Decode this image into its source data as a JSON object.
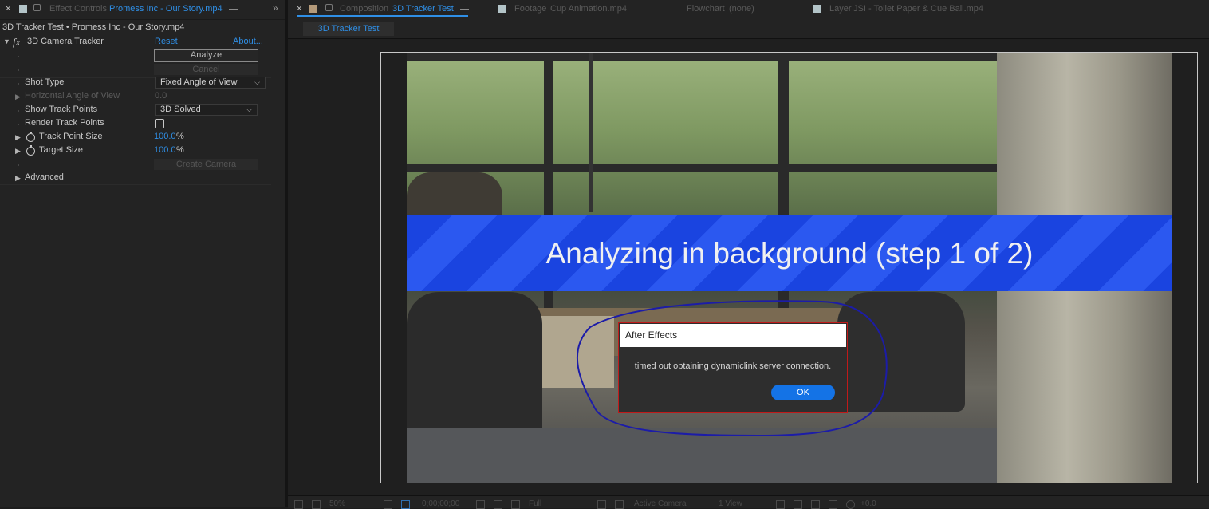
{
  "left_panel": {
    "tab_prefix": "Effect Controls",
    "tab_file": "Promess Inc - Our Story.mp4",
    "layer_path": "3D Tracker Test • Promess Inc - Our Story.mp4",
    "effect_name": "3D Camera Tracker",
    "reset_label": "Reset",
    "about_label": "About...",
    "analyze_label": "Analyze",
    "cancel_label": "Cancel",
    "create_camera_label": "Create Camera",
    "properties": {
      "shot_type": {
        "label": "Shot Type",
        "value": "Fixed Angle of View"
      },
      "horizontal_aov": {
        "label": "Horizontal Angle of View",
        "value": "0.0"
      },
      "show_track_points": {
        "label": "Show Track Points",
        "value": "3D Solved"
      },
      "render_track_points": {
        "label": "Render Track Points",
        "checked": false
      },
      "track_point_size": {
        "label": "Track Point Size",
        "value": "100.0",
        "unit": "%"
      },
      "target_size": {
        "label": "Target Size",
        "value": "100.0",
        "unit": "%"
      },
      "advanced": {
        "label": "Advanced"
      }
    }
  },
  "right_panel": {
    "tabs": [
      {
        "prefix": "Composition",
        "name": "3D Tracker Test",
        "active": true
      },
      {
        "prefix": "Footage",
        "name": "Cup Animation.mp4"
      },
      {
        "prefix": "Flowchart",
        "name": "(none)"
      },
      {
        "prefix": "Layer",
        "name": "JSI - Toilet Paper & Cue Ball.mp4"
      }
    ],
    "subtab": "3D Tracker Test"
  },
  "viewer": {
    "banner_text": "Analyzing in background (step 1 of 2)"
  },
  "dialog": {
    "title": "After Effects",
    "message": "timed out obtaining dynamiclink server connection.",
    "ok_label": "OK"
  },
  "bottom_bar": {
    "zoom": "50%",
    "timecode": "0;00;00;00",
    "resolution": "Full",
    "camera": "Active Camera",
    "views": "1 View",
    "exposure": "+0.0"
  },
  "colors": {
    "accent": "#2f8fe6",
    "banner": "#1a44e0",
    "dialog_border": "#c01a1a",
    "ok_button": "#1473e6",
    "annotation": "#1c1ca8"
  },
  "icons": [
    "close-icon",
    "color-label-icon",
    "lock-icon",
    "panel-menu-icon",
    "overflow-chevron-icon",
    "fx-icon",
    "stopwatch-icon",
    "disclosure-triangle-icon",
    "dropdown-chevron-icon"
  ]
}
